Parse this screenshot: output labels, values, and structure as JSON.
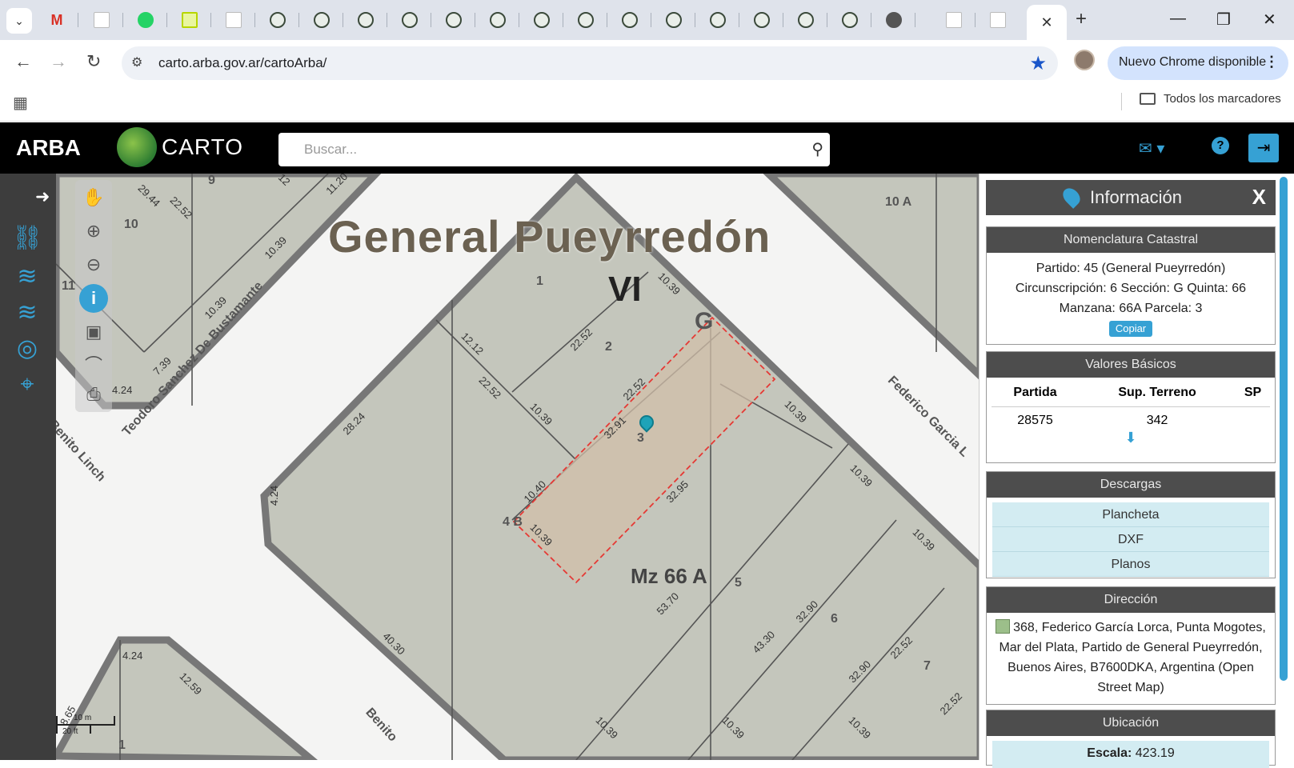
{
  "browser": {
    "active_tab_close": "✕",
    "new_tab": "+",
    "url": "carto.arba.gov.ar/cartoArba/",
    "update_label": "Nuevo Chrome disponible",
    "bookmarks_folder": "Todos los marcadores"
  },
  "header": {
    "arba_logo": "ARBA",
    "carto_logo": "CARTO",
    "search_placeholder": "Buscar..."
  },
  "map": {
    "place_title": "General Pueyrredón",
    "circ_label": "VI",
    "section_label": "G",
    "manzana_label": "Mz 66 A",
    "zone_label": "10 A",
    "scale_top": "10 m",
    "scale_bottom": "20 ft",
    "streets": [
      "Teodoro Sanchez De Bustamante",
      "Benito Linch",
      "Federico Garcia L",
      "Benito"
    ],
    "parcels": [
      "1",
      "2",
      "3",
      "4 B",
      "5",
      "6",
      "7",
      "9",
      "10",
      "11",
      "1"
    ],
    "measures": [
      "10.39",
      "22.52",
      "12.12",
      "22.52",
      "10.39",
      "22.52",
      "32.91",
      "10.40",
      "10.39",
      "32.95",
      "10.39",
      "10.39",
      "10.39",
      "28.24",
      "4.24",
      "40.30",
      "53.70",
      "43.30",
      "32.90",
      "32.90",
      "22.52",
      "22.52",
      "10.39",
      "10.39",
      "10.39",
      "29.44",
      "22.52",
      "11.20",
      "10.39",
      "10.39",
      "7.39",
      "4.24",
      "4.24",
      "12.59",
      "8.65",
      "12"
    ]
  },
  "info": {
    "title": "Información",
    "close": "X",
    "nomenclatura": {
      "head": "Nomenclatura Catastral",
      "line1": "Partido: 45 (General Pueyrredón)",
      "line2": "Circunscripción: 6 Sección: G Quinta: 66",
      "line3": "Manzana: 66A Parcela: 3",
      "copy_label": "Copiar"
    },
    "valores": {
      "head": "Valores Básicos",
      "columns": [
        "Partida",
        "Sup. Terreno",
        "SP"
      ],
      "row": [
        "28575",
        "342",
        ""
      ]
    },
    "descargas": {
      "head": "Descargas",
      "items": [
        "Plancheta",
        "DXF",
        "Planos"
      ]
    },
    "direccion": {
      "head": "Dirección",
      "text": "368, Federico García Lorca, Punta Mogotes, Mar del Plata, Partido de General Pueyrredón, Buenos Aires, B7600DKA, Argentina (Open Street Map)"
    },
    "ubicacion": {
      "head": "Ubicación",
      "scale_label": "Escala:",
      "scale_value": "423.19"
    }
  }
}
